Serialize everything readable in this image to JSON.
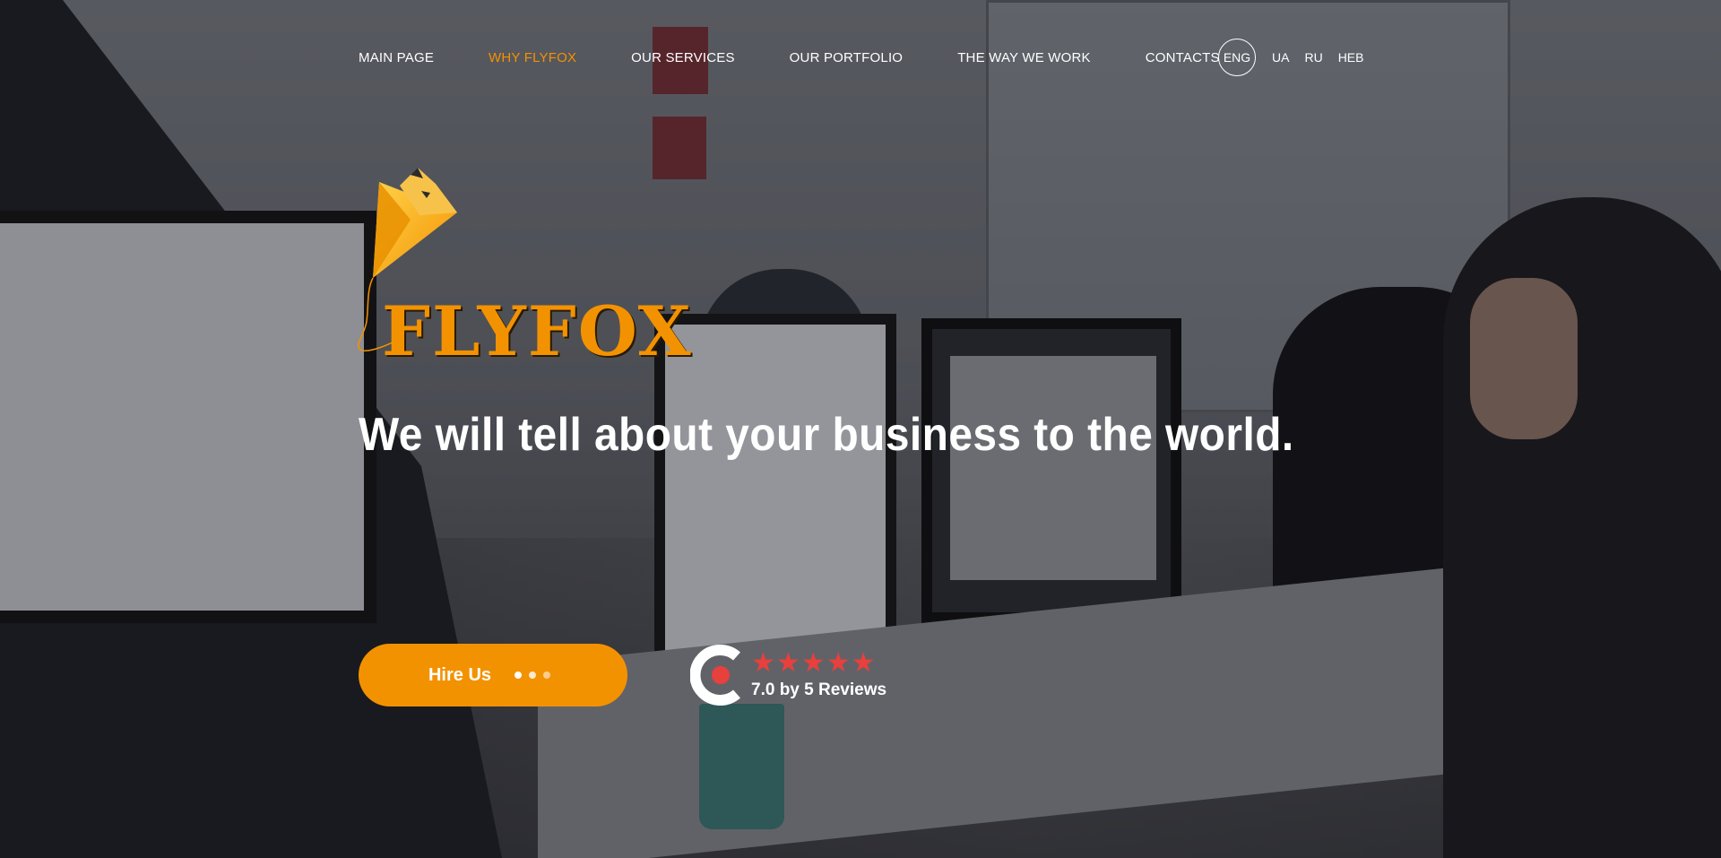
{
  "nav": {
    "items": [
      {
        "label": "MAIN PAGE"
      },
      {
        "label": "WHY FLYFOX"
      },
      {
        "label": "OUR SERVICES"
      },
      {
        "label": "OUR PORTFOLIO"
      },
      {
        "label": "THE WAY WE WORK"
      },
      {
        "label": "CONTACTS"
      }
    ],
    "active": "WHY FLYFOX"
  },
  "languages": {
    "current": "ENG",
    "others": [
      "UA",
      "RU",
      "HEB"
    ]
  },
  "brand": {
    "name": "FLYFOX",
    "logo_icon": "fox-kite-icon"
  },
  "hero": {
    "headline": "We will tell about your business to the world."
  },
  "cta": {
    "label": "Hire Us"
  },
  "rating": {
    "icon": "clutch-logo-icon",
    "stars": 5,
    "text": "7.0 by 5 Reviews"
  },
  "colors": {
    "accent": "#f39200",
    "star": "#e8403c",
    "text": "#ffffff"
  }
}
